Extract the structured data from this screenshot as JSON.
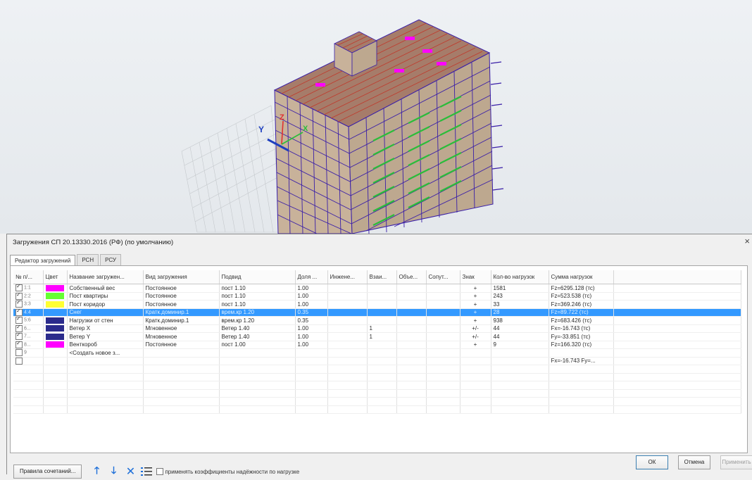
{
  "dialog": {
    "title": "Загружения СП 20.13330.2016 (РФ) (по умолчанию)",
    "close_glyph": "×",
    "tabs": [
      {
        "label": "Редактор загружений"
      },
      {
        "label": "РСН"
      },
      {
        "label": "РСУ"
      }
    ],
    "columns": [
      "№ п/...",
      "Цвет",
      "Название загружен...",
      "Вид загружения",
      "Подвид",
      "Доля ...",
      "Инжене...",
      "Взаи...",
      "Объе...",
      "Сопут...",
      "Знак",
      "Кол-во нагрузок",
      "Сумма нагрузок"
    ],
    "rows": [
      {
        "checked": true,
        "num": "1:1",
        "color": "#ff00ff",
        "name": "Собственный вес",
        "type": "Постоянное",
        "subtype": "пост 1.10",
        "share": "1.00",
        "eng": "",
        "vz": "",
        "ob": "",
        "sop": "",
        "sign": "+",
        "count": "1581",
        "sum": "Fz=6295.128 (тс)",
        "selected": false
      },
      {
        "checked": true,
        "num": "2:2",
        "color": "#66ff33",
        "name": "Пост квартиры",
        "type": "Постоянное",
        "subtype": "пост 1.10",
        "share": "1.00",
        "eng": "",
        "vz": "",
        "ob": "",
        "sop": "",
        "sign": "+",
        "count": "243",
        "sum": "Fz=523.538 (тс)",
        "selected": false
      },
      {
        "checked": true,
        "num": "3:3",
        "color": "#ffff33",
        "name": "Пост коридор",
        "type": "Постоянное",
        "subtype": "пост 1.10",
        "share": "1.00",
        "eng": "",
        "vz": "",
        "ob": "",
        "sop": "",
        "sign": "+",
        "count": "33",
        "sum": "Fz=369.246 (тс)",
        "selected": false
      },
      {
        "checked": true,
        "num": "4:4",
        "color": "#3399ff",
        "name": "Снег",
        "type": "Кратк.доминир.1",
        "subtype": "врем.кр 1.20",
        "share": "0.35",
        "eng": "",
        "vz": "",
        "ob": "",
        "sop": "",
        "sign": "+",
        "count": "28",
        "sum": "Fz=89.722 (тс)",
        "selected": true
      },
      {
        "checked": true,
        "num": "5:6",
        "color": "#2b2b8c",
        "name": "Нагрузки от стен",
        "type": "Кратк.доминир.1",
        "subtype": "врем.кр 1.20",
        "share": "0.35",
        "eng": "",
        "vz": "",
        "ob": "",
        "sop": "",
        "sign": "+",
        "count": "938",
        "sum": "Fz=683.426 (тс)",
        "selected": false
      },
      {
        "checked": true,
        "num": "6...",
        "color": "#2b2b8c",
        "name": "Ветер X",
        "type": "Мгновенное",
        "subtype": "Ветер 1.40",
        "share": "1.00",
        "eng": "",
        "vz": "1",
        "ob": "",
        "sop": "",
        "sign": "+/-",
        "count": "44",
        "sum": "Fx=-16.743 (тс)",
        "selected": false
      },
      {
        "checked": true,
        "num": "7...",
        "color": "#2b2b8c",
        "name": "Ветер Y",
        "type": "Мгновенное",
        "subtype": "Ветер 1.40",
        "share": "1.00",
        "eng": "",
        "vz": "1",
        "ob": "",
        "sop": "",
        "sign": "+/-",
        "count": "44",
        "sum": "Fy=-33.851 (тс)",
        "selected": false
      },
      {
        "checked": true,
        "num": "8...",
        "color": "#ff00ff",
        "name": "Венткороб",
        "type": "Постоянное",
        "subtype": "пост 1.00",
        "share": "1.00",
        "eng": "",
        "vz": "",
        "ob": "",
        "sop": "",
        "sign": "+",
        "count": "9",
        "sum": "Fz=166.320 (тс)",
        "selected": false
      },
      {
        "checked": false,
        "num": "9",
        "color": "",
        "name": "<Создать новое з...",
        "type": "",
        "subtype": "",
        "share": "",
        "eng": "",
        "vz": "",
        "ob": "",
        "sop": "",
        "sign": "",
        "count": "",
        "sum": "",
        "selected": false
      },
      {
        "checked": false,
        "num": "",
        "color": "",
        "name": "",
        "type": "",
        "subtype": "",
        "share": "",
        "eng": "",
        "vz": "",
        "ob": "",
        "sop": "",
        "sign": "",
        "count": "",
        "sum": "Fx=-16.743 Fy=...",
        "selected": false
      }
    ],
    "combination_rules_label": "Правила сочетаний...",
    "reliability_checkbox_label": "применять коэффициенты надёжности по нагрузке",
    "ok_label": "ОК",
    "cancel_label": "Отмена",
    "apply_label": "Применить"
  },
  "viewport": {
    "axes": {
      "x": "X",
      "y": "Y",
      "z": "Z"
    },
    "colors": {
      "facade": "#c8b29a",
      "grid_line": "#3a1fa8",
      "roof_line": "#c0392b",
      "slab": "#2bbd3a",
      "magenta": "#ff00ff"
    }
  }
}
